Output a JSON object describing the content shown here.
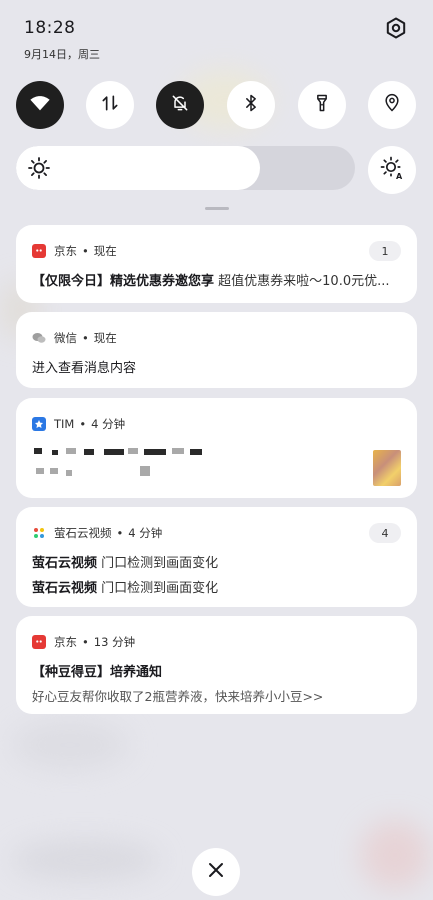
{
  "status": {
    "time": "18:28",
    "date": "9月14日，周三"
  },
  "icons": {
    "settings": "gear-icon",
    "wifi": "wifi-icon",
    "data": "mobile-data-icon",
    "mute": "bell-off-icon",
    "bluetooth": "bluetooth-icon",
    "flashlight": "flashlight-icon",
    "location": "location-icon",
    "brightness": "sun-icon",
    "auto_brightness": "auto-brightness-icon",
    "close": "close-icon"
  },
  "quick_settings": [
    {
      "name": "wifi",
      "on": true
    },
    {
      "name": "mobile-data",
      "on": false
    },
    {
      "name": "mute",
      "on": true
    },
    {
      "name": "bluetooth",
      "on": false
    },
    {
      "name": "flashlight",
      "on": false
    },
    {
      "name": "location",
      "on": false
    }
  ],
  "brightness": {
    "level": 0.72
  },
  "notifications": [
    {
      "app": "京东",
      "sep": "•",
      "when": "现在",
      "count": "1",
      "icon_color": "#e53935",
      "title": "【仅限今日】精选优惠券邀您享",
      "text": "超值优惠券来啦～10.0元优..."
    },
    {
      "app": "微信",
      "sep": "•",
      "when": "现在",
      "icon_color": "#9e9e9e",
      "text": "进入查看消息内容"
    },
    {
      "app": "TIM",
      "sep": "•",
      "when": "4 分钟",
      "icon_color": "#2b78e4"
    },
    {
      "app": "萤石云视频",
      "sep": "•",
      "when": "4 分钟",
      "count": "4",
      "lines": [
        {
          "title": "萤石云视频",
          "text": "门口检测到画面变化"
        },
        {
          "title": "萤石云视频",
          "text": "门口检测到画面变化"
        }
      ]
    },
    {
      "app": "京东",
      "sep": "•",
      "when": "13 分钟",
      "icon_color": "#e53935",
      "title": "【种豆得豆】培养通知",
      "text": "好心豆友帮你收取了2瓶营养液，快来培养小小豆>>"
    }
  ]
}
